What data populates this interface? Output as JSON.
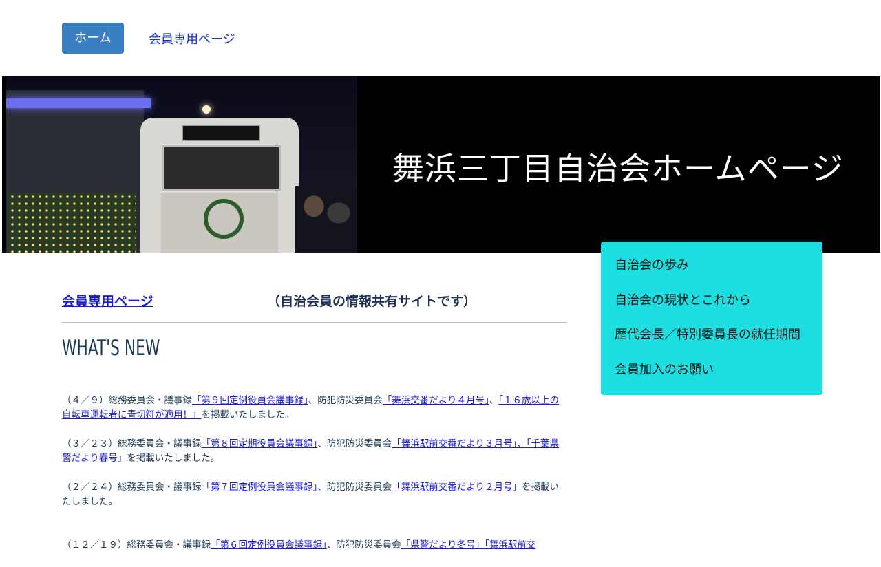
{
  "nav": {
    "home_label": "ホーム",
    "member_label": "会員専用ページ"
  },
  "hero": {
    "title": "舞浜三丁目自治会ホームページ"
  },
  "side_menu": {
    "items": [
      {
        "label": "自治会の歩み"
      },
      {
        "label": "自治会の現状とこれから"
      },
      {
        "label": "歴代会長／特別委員長の就任期間"
      },
      {
        "label": "会員加入のお願い"
      }
    ]
  },
  "main": {
    "member_link": "会員専用ページ",
    "member_note": "（自治会員の情報共有サイトです）",
    "whats_new": "WHAT'S NEW",
    "news": [
      {
        "date": "（４／９）総務委員会・議事録",
        "link1": "「第９回定例役員会議事録」",
        "mid1": "、防犯防災委員会",
        "link2": "「舞浜交番だより４月号」",
        "mid2": "、",
        "link3": "「１６歳以上の自転車運転者に青切符が適用！」",
        "tail": "を掲載いたしました。"
      },
      {
        "date": "（３／２３）総務委員会・議事録",
        "link1": "「第８回定期役員会議事録」",
        "mid1": "、防犯防災委員会",
        "link2": "「舞浜駅前交番だより３月号」、",
        "mid2": "",
        "link3": "「千葉県警だより春号」",
        "tail": "を掲載いたしました。"
      },
      {
        "date": "（２／２４）総務委員会・議事録",
        "link1": "「第７回定例役員会議事録」",
        "mid1": "、防犯防災委員会",
        "link2": "「舞浜駅前交番だより２月号」",
        "mid2": "",
        "link3": "",
        "tail": "を掲載いたしました。"
      },
      {
        "date": "（１２／１９）総務委員会・議事録",
        "link1": "「第６回定例役員会議事録」",
        "mid1": "、防犯防災委員会",
        "link2": "「県警だより冬号」",
        "mid2": "、",
        "link3": "「舞浜駅前交",
        "tail": ""
      }
    ]
  }
}
